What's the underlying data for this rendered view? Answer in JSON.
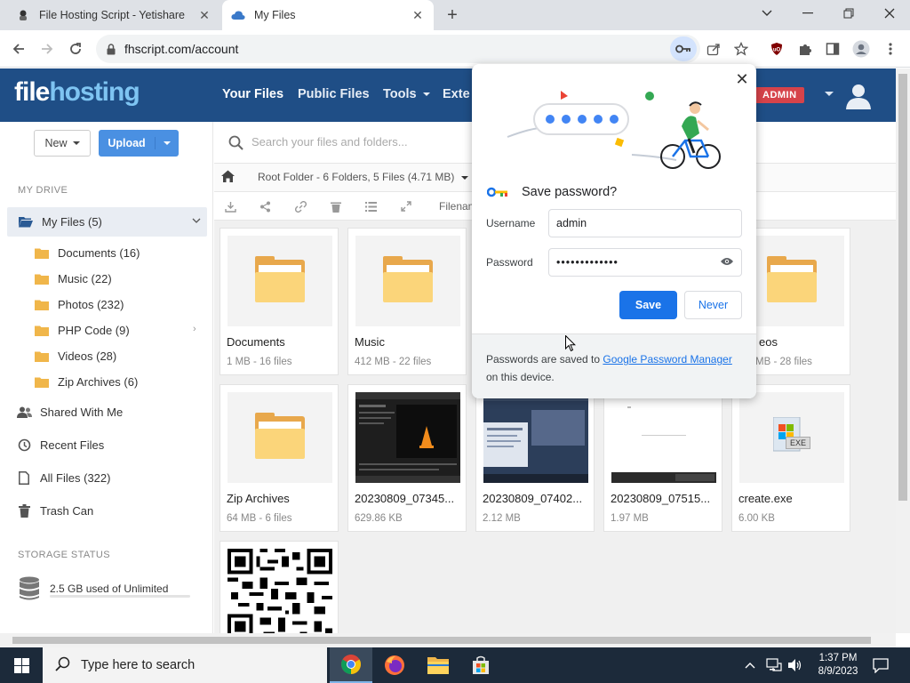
{
  "browser": {
    "tabs": [
      {
        "title": "File Hosting Script - Yetishare",
        "active": false
      },
      {
        "title": "My Files",
        "active": true
      }
    ],
    "url": "fhscript.com/account"
  },
  "header": {
    "logo_part1": "file",
    "logo_part2": "hosting",
    "nav": [
      "Your Files",
      "Public Files",
      "Tools",
      "Exte"
    ],
    "admin_badge": "ADMIN"
  },
  "sidebar": {
    "new_label": "New",
    "upload_label": "Upload",
    "drive_heading": "MY DRIVE",
    "my_files": "My Files (5)",
    "folders": [
      {
        "label": "Documents (16)"
      },
      {
        "label": "Music (22)"
      },
      {
        "label": "Photos (232)"
      },
      {
        "label": "PHP Code (9)"
      },
      {
        "label": "Videos (28)"
      },
      {
        "label": "Zip Archives (6)"
      }
    ],
    "links": [
      {
        "label": "Shared With Me"
      },
      {
        "label": "Recent Files"
      },
      {
        "label": "All Files (322)"
      },
      {
        "label": "Trash Can"
      }
    ],
    "storage_heading": "STORAGE STATUS",
    "storage_text": "2.5 GB used of Unlimited"
  },
  "main": {
    "search_placeholder": "Search your files and folders...",
    "breadcrumb": "Root Folder - 6 Folders, 5 Files (4.71 MB)",
    "sort_label": "Filenam",
    "items": [
      {
        "name": "Documents",
        "meta": "1 MB - 16 files",
        "type": "folder"
      },
      {
        "name": "Music",
        "meta": "412 MB - 22 files",
        "type": "folder"
      },
      {
        "name": "eos",
        "meta": "MB - 28 files",
        "type": "folder"
      },
      {
        "name": "Zip Archives",
        "meta": "64 MB - 6 files",
        "type": "folder"
      },
      {
        "name": "20230809_07345...",
        "meta": "629.86 KB",
        "type": "image"
      },
      {
        "name": "20230809_07402...",
        "meta": "2.12 MB",
        "type": "image"
      },
      {
        "name": "20230809_07515...",
        "meta": "1.97 MB",
        "type": "image"
      },
      {
        "name": "create.exe",
        "meta": "6.00 KB",
        "type": "exe"
      },
      {
        "name": "",
        "meta": "",
        "type": "qr"
      }
    ],
    "exe_badge": "EXE"
  },
  "password_popup": {
    "title": "Save password?",
    "username_label": "Username",
    "username_value": "admin",
    "password_label": "Password",
    "password_value": "•••••••••••••",
    "save_label": "Save",
    "never_label": "Never",
    "footer_prefix": "Passwords are saved to ",
    "footer_link": "Google Password Manager",
    "footer_suffix": " on this device."
  },
  "taskbar": {
    "search_placeholder": "Type here to search",
    "time": "1:37 PM",
    "date": "8/9/2023"
  },
  "colors": {
    "header_bg": "#1f4e86",
    "accent": "#4a90e2",
    "admin_badge": "#d6434a",
    "chrome_blue": "#1a73e8"
  }
}
